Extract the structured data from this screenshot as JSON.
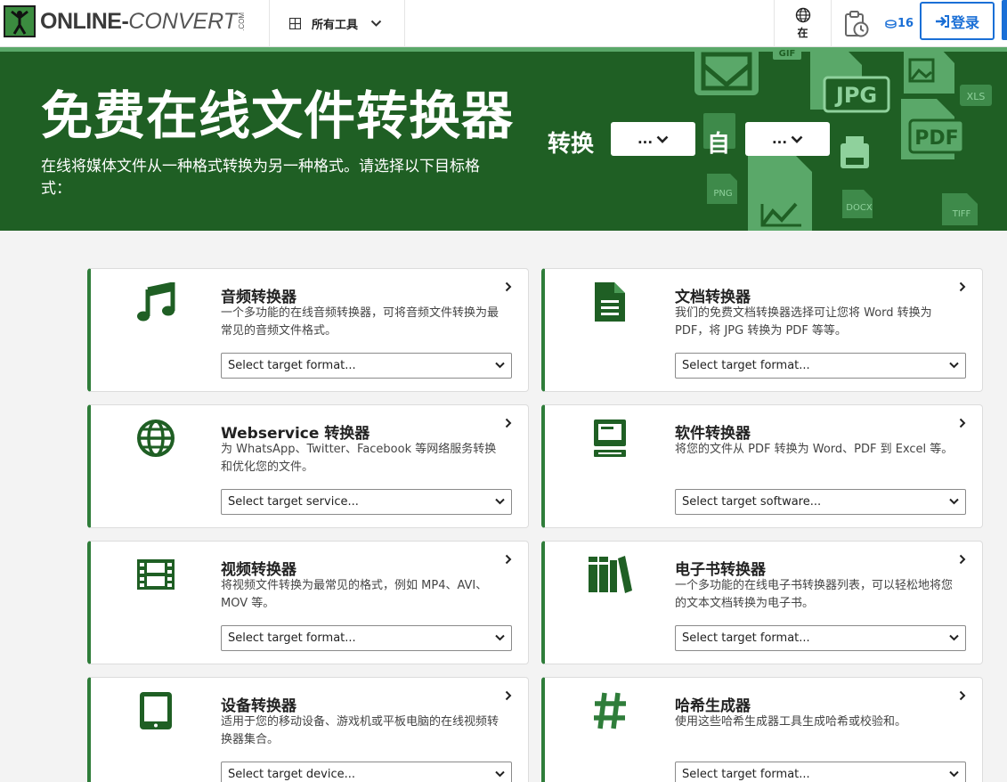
{
  "header": {
    "logo_text_online": "ONLINE-",
    "logo_text_convert": "CONVERT",
    "logo_com": ".COM",
    "all_tools_label": "所有工具",
    "language_label": "在",
    "credits_count": "16",
    "login_label": "登录"
  },
  "hero": {
    "title": "免费在线文件转换器",
    "subtitle": "在线将媒体文件从一种格式转换为另一种格式。请选择以下目标格式：",
    "convert_label": "转换",
    "to_label": "自",
    "from_value": "...",
    "to_value": "...",
    "art_labels": [
      "GIF",
      "JPG",
      "PDF",
      "XLS",
      "PNG",
      "DOCX",
      "TIFF"
    ]
  },
  "cards": [
    {
      "title": "音频转换器",
      "desc": "一个多功能的在线音频转换器，可将音频文件转换为最常见的音频文件格式。",
      "select": "Select target format...",
      "icon": "music-note-icon"
    },
    {
      "title": "文档转换器",
      "desc": "我们的免费文档转换器选择可让您将 Word 转换为 PDF，将 JPG 转换为 PDF 等等。",
      "select": "Select target format...",
      "icon": "document-icon"
    },
    {
      "title": "Webservice 转换器",
      "desc": "为 WhatsApp、Twitter、Facebook 等网络服务转换和优化您的文件。",
      "select": "Select target service...",
      "icon": "globe-icon"
    },
    {
      "title": "软件转换器",
      "desc": "将您的文件从 PDF 转换为 Word、PDF 到 Excel 等。",
      "select": "Select target software...",
      "icon": "computer-icon"
    },
    {
      "title": "视频转换器",
      "desc": "将视频文件转换为最常见的格式，例如 MP4、AVI、MOV 等。",
      "select": "Select target format...",
      "icon": "film-icon"
    },
    {
      "title": "电子书转换器",
      "desc": "一个多功能的在线电子书转换器列表，可以轻松地将您的文本文档转换为电子书。",
      "select": "Select target format...",
      "icon": "books-icon"
    },
    {
      "title": "设备转换器",
      "desc": "适用于您的移动设备、游戏机或平板电脑的在线视频转换器集合。",
      "select": "Select target device...",
      "icon": "tablet-icon"
    },
    {
      "title": "哈希生成器",
      "desc": "使用这些哈希生成器工具生成哈希或校验和。",
      "select": "Select target format...",
      "icon": "hash-icon"
    }
  ],
  "colors": {
    "hero_bg": "#1f5f24",
    "accent_green": "#2f7d3a",
    "link_blue": "#1a6fd6"
  }
}
